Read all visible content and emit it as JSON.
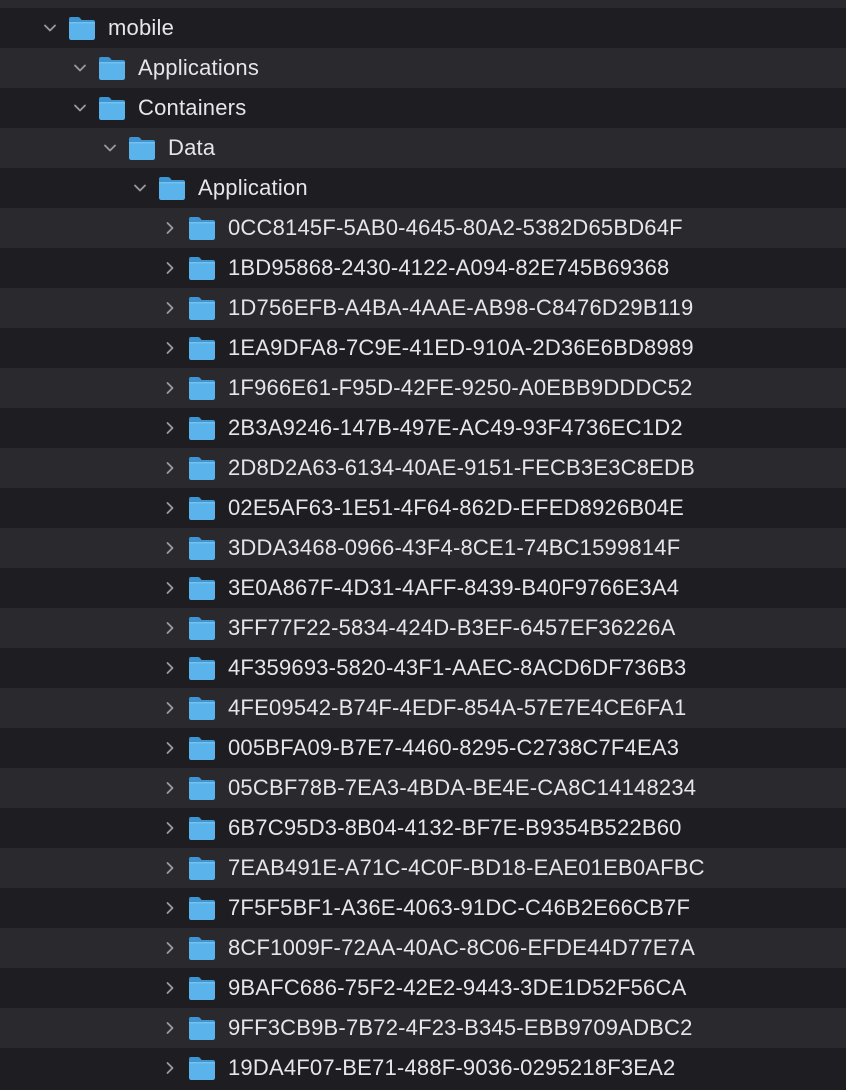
{
  "icons": {
    "folder": "folder-icon",
    "expanded": "chevron-down-icon",
    "collapsed": "chevron-right-icon"
  },
  "colors": {
    "background": "#1e1e22",
    "alt_row": "#2a2a2e",
    "text": "#e6e6e9",
    "folder": "#5ab3ea",
    "chevron": "#9a9aa0"
  },
  "tree": {
    "partial_top": {
      "expanded": false
    },
    "mobile": {
      "label": "mobile",
      "expanded": true
    },
    "applications": {
      "label": "Applications",
      "expanded": true
    },
    "containers": {
      "label": "Containers",
      "expanded": true
    },
    "data": {
      "label": "Data",
      "expanded": true
    },
    "application": {
      "label": "Application",
      "expanded": true
    },
    "app_folders": [
      {
        "label": "0CC8145F-5AB0-4645-80A2-5382D65BD64F",
        "expanded": false
      },
      {
        "label": "1BD95868-2430-4122-A094-82E745B69368",
        "expanded": false
      },
      {
        "label": "1D756EFB-A4BA-4AAE-AB98-C8476D29B119",
        "expanded": false
      },
      {
        "label": "1EA9DFA8-7C9E-41ED-910A-2D36E6BD8989",
        "expanded": false
      },
      {
        "label": "1F966E61-F95D-42FE-9250-A0EBB9DDDC52",
        "expanded": false
      },
      {
        "label": "2B3A9246-147B-497E-AC49-93F4736EC1D2",
        "expanded": false
      },
      {
        "label": "2D8D2A63-6134-40AE-9151-FECB3E3C8EDB",
        "expanded": false
      },
      {
        "label": "02E5AF63-1E51-4F64-862D-EFED8926B04E",
        "expanded": false
      },
      {
        "label": "3DDA3468-0966-43F4-8CE1-74BC1599814F",
        "expanded": false
      },
      {
        "label": "3E0A867F-4D31-4AFF-8439-B40F9766E3A4",
        "expanded": false
      },
      {
        "label": "3FF77F22-5834-424D-B3EF-6457EF36226A",
        "expanded": false
      },
      {
        "label": "4F359693-5820-43F1-AAEC-8ACD6DF736B3",
        "expanded": false
      },
      {
        "label": "4FE09542-B74F-4EDF-854A-57E7E4CE6FA1",
        "expanded": false
      },
      {
        "label": "005BFA09-B7E7-4460-8295-C2738C7F4EA3",
        "expanded": false
      },
      {
        "label": "05CBF78B-7EA3-4BDA-BE4E-CA8C14148234",
        "expanded": false
      },
      {
        "label": "6B7C95D3-8B04-4132-BF7E-B9354B522B60",
        "expanded": false
      },
      {
        "label": "7EAB491E-A71C-4C0F-BD18-EAE01EB0AFBC",
        "expanded": false
      },
      {
        "label": "7F5F5BF1-A36E-4063-91DC-C46B2E66CB7F",
        "expanded": false
      },
      {
        "label": "8CF1009F-72AA-40AC-8C06-EFDE44D77E7A",
        "expanded": false
      },
      {
        "label": "9BAFC686-75F2-42E2-9443-3DE1D52F56CA",
        "expanded": false
      },
      {
        "label": "9FF3CB9B-7B72-4F23-B345-EBB9709ADBC2",
        "expanded": false
      },
      {
        "label": "19DA4F07-BE71-488F-9036-0295218F3EA2",
        "expanded": false
      }
    ]
  }
}
